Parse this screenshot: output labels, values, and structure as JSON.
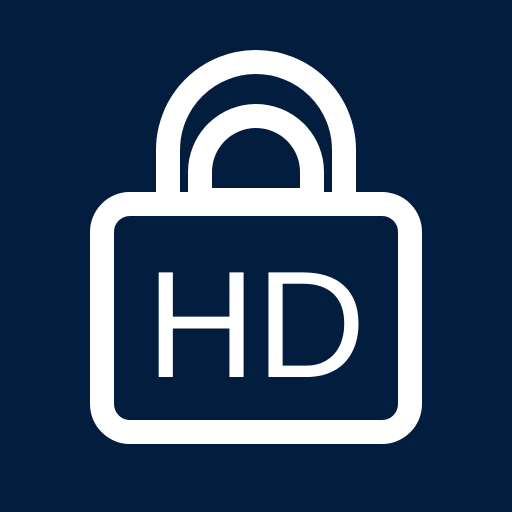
{
  "icon": {
    "name": "lock-hd-icon",
    "label": "HD",
    "colors": {
      "background": "#021D3D",
      "foreground": "#FFFFFF"
    }
  }
}
